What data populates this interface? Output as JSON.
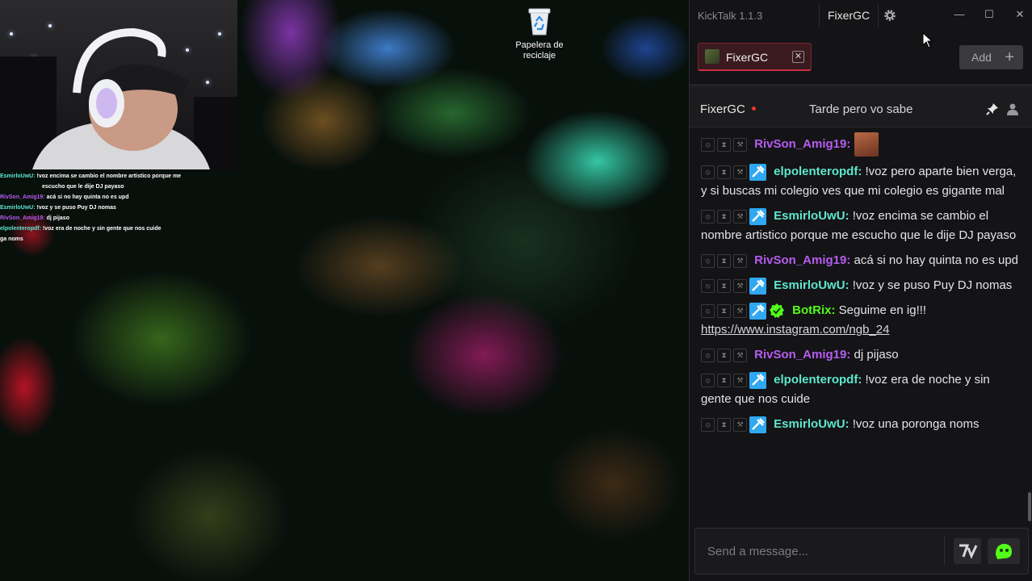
{
  "desktop": {
    "recycle_bin_label": "Papelera de reciclaje"
  },
  "overlay_chat": [
    {
      "user": "EsmirloUwU:",
      "text": "!voz encima se cambio el nombre artistico porque me",
      "cont": "escucho que le dije DJ payaso",
      "color": "green"
    },
    {
      "user": "RivSon_Amig19:",
      "text": "acá si no hay quinta no es upd",
      "cont": "",
      "color": "purple"
    },
    {
      "user": "EsmirloUwU:",
      "text": "!voz y se puso Puy DJ nomas",
      "cont": "",
      "color": "green"
    },
    {
      "user": "RivSon_Amig19:",
      "text": "dj pijaso",
      "cont": "",
      "color": "purple"
    },
    {
      "user": "elpolenteropdf:",
      "text": "!voz era de noche y sin gente que nos cuide",
      "cont": "",
      "color": "green"
    },
    {
      "user": "",
      "text": "ga noms",
      "cont": "",
      "color": "green"
    }
  ],
  "window": {
    "title": "KickTalk 1.1.3",
    "current_user": "FixerGC",
    "settings_icon": "gear-icon",
    "minimize_glyph": "—",
    "maximize_glyph": "☐",
    "close_glyph": "✕"
  },
  "tabs": {
    "items": [
      {
        "label": "FixerGC",
        "close_glyph": "✕"
      }
    ],
    "add_label": "Add",
    "add_glyph": "+"
  },
  "channel": {
    "name": "FixerGC",
    "stream_title": "Tarde pero vo sabe",
    "live_color": "#e33333"
  },
  "messages": [
    {
      "user": "RivSon_Amig19:",
      "color": "purple",
      "mod": false,
      "verified": false,
      "text": "",
      "emote": true,
      "link": ""
    },
    {
      "user": "elpolenteropdf:",
      "color": "teal",
      "mod": true,
      "verified": false,
      "text": "!voz pero aparte bien verga, y si buscas mi colegio ves que mi colegio es gigante mal",
      "emote": false,
      "link": ""
    },
    {
      "user": "EsmirloUwU:",
      "color": "teal",
      "mod": true,
      "verified": false,
      "text": "!voz encima se cambio el nombre artistico porque me escucho que le dije DJ payaso",
      "emote": false,
      "link": ""
    },
    {
      "user": "RivSon_Amig19:",
      "color": "purple",
      "mod": false,
      "verified": false,
      "text": "acá si no hay quinta no es upd",
      "emote": false,
      "link": ""
    },
    {
      "user": "EsmirloUwU:",
      "color": "teal",
      "mod": true,
      "verified": false,
      "text": "!voz y se puso Puy DJ nomas",
      "emote": false,
      "link": ""
    },
    {
      "user": "BotRix:",
      "color": "green",
      "mod": true,
      "verified": true,
      "text": "Seguime en ig!!!",
      "emote": false,
      "link": "https://www.instagram.com/ngb_24"
    },
    {
      "user": "RivSon_Amig19:",
      "color": "purple",
      "mod": false,
      "verified": false,
      "text": "dj pijaso",
      "emote": false,
      "link": ""
    },
    {
      "user": "elpolenteropdf:",
      "color": "teal",
      "mod": true,
      "verified": false,
      "text": "!voz era de noche y sin gente que nos cuide",
      "emote": false,
      "link": ""
    },
    {
      "user": "EsmirloUwU:",
      "color": "teal",
      "mod": true,
      "verified": false,
      "text": "!voz una poronga noms",
      "emote": false,
      "link": ""
    }
  ],
  "input": {
    "placeholder": "Send a message...",
    "value": ""
  },
  "colors": {
    "accent_kick": "#53fc18",
    "username_purple": "#b65cf0",
    "username_teal": "#5fe6d0",
    "mod_badge": "#2fa8f0",
    "tab_active": "#c73040"
  }
}
